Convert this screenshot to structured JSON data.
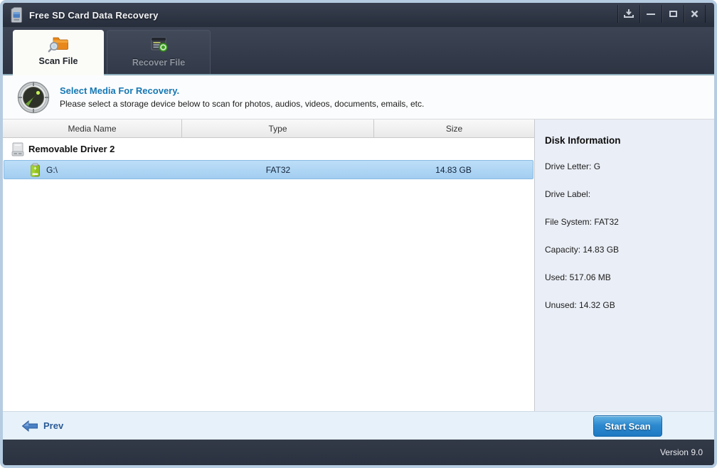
{
  "window": {
    "title": "Free SD Card Data Recovery",
    "control_icons": [
      "download-icon",
      "minimize-icon",
      "maximize-icon",
      "close-icon"
    ]
  },
  "tabs": {
    "scan": {
      "label": "Scan File",
      "active": true,
      "icon": "folder-search-icon"
    },
    "recover": {
      "label": "Recover File",
      "active": false,
      "icon": "document-recover-icon"
    }
  },
  "header": {
    "icon": "radar-icon",
    "title": "Select Media For Recovery.",
    "subtitle": "Please select a storage device below to scan for photos, audios, videos, documents, emails, etc."
  },
  "device_table": {
    "columns": [
      "Media Name",
      "Type",
      "Size"
    ],
    "group_label": "Removable Driver 2",
    "rows": [
      {
        "name": "G:\\",
        "type": "FAT32",
        "size": "14.83 GB",
        "selected": true,
        "icon": "usb-drive-icon"
      }
    ]
  },
  "disk_info": {
    "title": "Disk Information",
    "lines": [
      "Drive Letter: G",
      "Drive Label:",
      "File System: FAT32",
      "Capacity: 14.83 GB",
      "Used: 517.06 MB",
      "Unused: 14.32 GB"
    ]
  },
  "actions": {
    "prev_label": "Prev",
    "start_scan_label": "Start Scan"
  },
  "statusbar": {
    "version": "Version 9.0"
  },
  "colors": {
    "titlebar": "#2c3342",
    "accent_blue": "#1678b4",
    "selected_row": "#aed3f2",
    "button_blue": "#1d79c2",
    "panel_bg": "#eaeef6",
    "footer_bg": "#2c3340",
    "tab_underline": "#8fb0bd"
  }
}
